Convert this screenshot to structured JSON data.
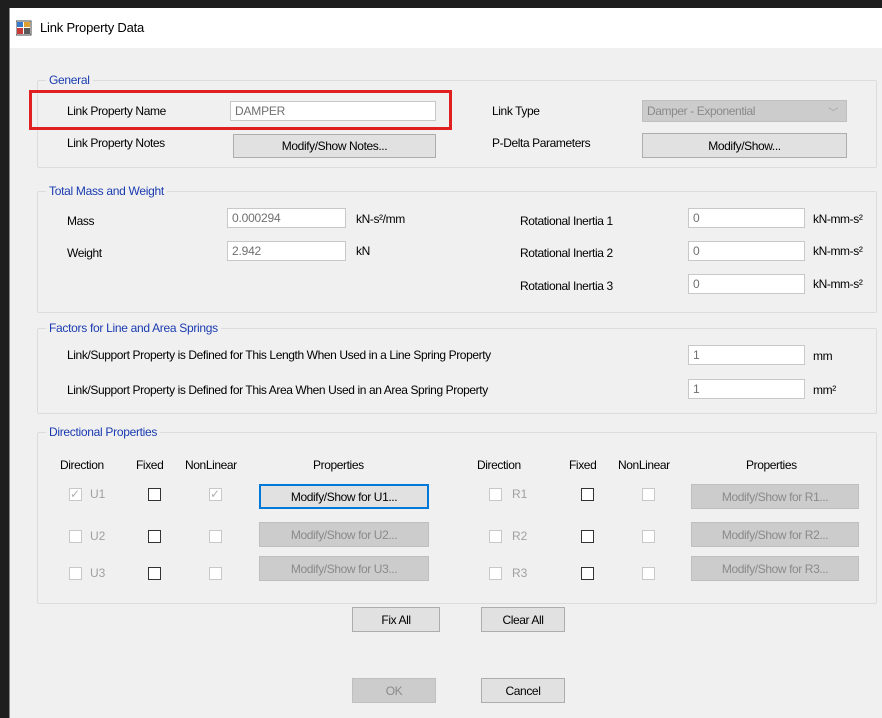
{
  "window": {
    "title": "Link Property Data",
    "icon": "app-grid-icon"
  },
  "general": {
    "label": "General",
    "name_label": "Link Property Name",
    "name_value": "DAMPER",
    "notes_label": "Link Property Notes",
    "notes_button": "Modify/Show Notes...",
    "type_label": "Link Type",
    "type_value": "Damper - Exponential",
    "pdelta_label": "P-Delta Parameters",
    "pdelta_button": "Modify/Show..."
  },
  "mass": {
    "label": "Total Mass and Weight",
    "mass_label": "Mass",
    "mass_value": "0.000294",
    "mass_unit": "kN-s²/mm",
    "weight_label": "Weight",
    "weight_value": "2.942",
    "weight_unit": "kN",
    "inertia": [
      {
        "label": "Rotational Inertia 1",
        "value": "0",
        "unit": "kN-mm-s²"
      },
      {
        "label": "Rotational Inertia 2",
        "value": "0",
        "unit": "kN-mm-s²"
      },
      {
        "label": "Rotational Inertia 3",
        "value": "0",
        "unit": "kN-mm-s²"
      }
    ]
  },
  "factors": {
    "label": "Factors for Line and Area Springs",
    "line_label": "Link/Support Property is Defined for This Length When Used in a Line Spring Property",
    "line_value": "1",
    "line_unit": "mm",
    "area_label": "Link/Support Property is Defined for This Area When Used in an Area Spring Property",
    "area_value": "1",
    "area_unit": "mm²"
  },
  "directional": {
    "label": "Directional Properties",
    "headers": {
      "direction": "Direction",
      "fixed": "Fixed",
      "nonlinear": "NonLinear",
      "properties": "Properties"
    },
    "left": [
      {
        "dir": "U1",
        "dir_checked": true,
        "fixed": false,
        "nonlinear": true,
        "button": "Modify/Show for U1...",
        "enabled": true
      },
      {
        "dir": "U2",
        "dir_checked": false,
        "fixed": false,
        "nonlinear": false,
        "button": "Modify/Show for U2...",
        "enabled": false
      },
      {
        "dir": "U3",
        "dir_checked": false,
        "fixed": false,
        "nonlinear": false,
        "button": "Modify/Show for U3...",
        "enabled": false
      }
    ],
    "right": [
      {
        "dir": "R1",
        "dir_checked": false,
        "fixed": false,
        "nonlinear": false,
        "button": "Modify/Show for R1...",
        "enabled": false
      },
      {
        "dir": "R2",
        "dir_checked": false,
        "fixed": false,
        "nonlinear": false,
        "button": "Modify/Show for R2...",
        "enabled": false
      },
      {
        "dir": "R3",
        "dir_checked": false,
        "fixed": false,
        "nonlinear": false,
        "button": "Modify/Show for R3...",
        "enabled": false
      }
    ],
    "fix_all": "Fix All",
    "clear_all": "Clear All"
  },
  "footer": {
    "ok": "OK",
    "cancel": "Cancel"
  },
  "colors": {
    "group_label": "#1a3bb0",
    "highlight": "#e02020",
    "focus": "#0078d7"
  }
}
